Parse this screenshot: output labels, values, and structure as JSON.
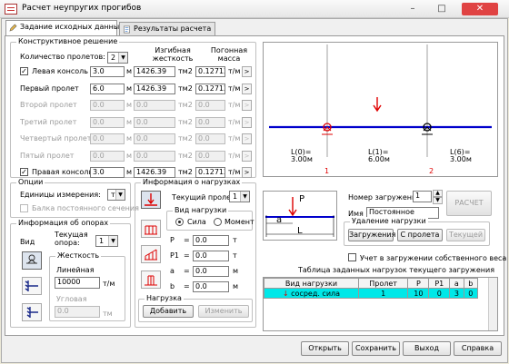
{
  "window": {
    "title": "Расчет неупругих прогибов",
    "controls": [
      "–",
      "□",
      "✕"
    ]
  },
  "tabs": [
    {
      "label": "Задание исходных данных"
    },
    {
      "label": "Результаты расчета"
    }
  ],
  "construct": {
    "legend": "Конструктивное решение",
    "spans_label": "Количество пролетов:",
    "spans_value": "2",
    "hdr_stiff": "Изгибная жесткость",
    "hdr_mass": "Погонная масса",
    "rows": [
      {
        "label": "Левая консоль",
        "checked": true,
        "len": "3.0",
        "unit": "м",
        "stiff": "1426.39",
        "su": "тм2",
        "mass": "0.127125",
        "mu": "т/м",
        "enabled": true
      },
      {
        "label": "Первый пролет",
        "len": "6.0",
        "unit": "м",
        "stiff": "1426.39",
        "su": "тм2",
        "mass": "0.127125",
        "mu": "т/м",
        "enabled": true
      },
      {
        "label": "Второй пролет",
        "len": "0.0",
        "unit": "м",
        "stiff": "0.0",
        "su": "тм2",
        "mass": "0.0",
        "mu": "т/м",
        "enabled": false
      },
      {
        "label": "Третий пролет",
        "len": "0.0",
        "unit": "м",
        "stiff": "0.0",
        "su": "тм2",
        "mass": "0.0",
        "mu": "т/м",
        "enabled": false
      },
      {
        "label": "Четвертый пролет",
        "len": "0.0",
        "unit": "м",
        "stiff": "0.0",
        "su": "тм2",
        "mass": "0.0",
        "mu": "т/м",
        "enabled": false
      },
      {
        "label": "Пятый пролет",
        "len": "0.0",
        "unit": "м",
        "stiff": "0.0",
        "su": "тм2",
        "mass": "0.0",
        "mu": "т/м",
        "enabled": false
      },
      {
        "label": "Правая консоль",
        "checked": true,
        "len": "3.0",
        "unit": "м",
        "stiff": "1426.39",
        "su": "тм2",
        "mass": "0.127125",
        "mu": "т/м",
        "enabled": true
      }
    ],
    "row_button": ">"
  },
  "diagram": {
    "labels": [
      {
        "t": "L(0)=",
        "v": "3.00м"
      },
      {
        "t": "L(1)=",
        "v": "6.00м"
      },
      {
        "t": "L(6)=",
        "v": "3.00м"
      }
    ],
    "support_numbers": [
      "1",
      "2"
    ],
    "colors": {
      "beam": "#0000cc",
      "load": "#e00000",
      "support_num": "#e00000"
    }
  },
  "options": {
    "legend": "Опции",
    "units_label": "Единицы измерения:",
    "units_value": "т",
    "const_section": "Балка постоянного сечения"
  },
  "supports": {
    "legend": "Информация об опорах",
    "view": "Вид",
    "current_label": "Текущая опора:",
    "current_value": "1",
    "stiff_legend": "Жесткость",
    "linear_label": "Линейная",
    "linear_value": "10000",
    "linear_unit": "т/м",
    "angular_label": "Угловая",
    "angular_value": "0.0",
    "angular_unit": "тм"
  },
  "loads": {
    "legend": "Информация о нагрузках",
    "span_label": "Текущий пролет:",
    "span_value": "1",
    "type_legend": "Вид нагрузки",
    "type_force": "Сила",
    "type_moment": "Момент",
    "fields": [
      {
        "label": "P",
        "value": "0.0",
        "unit": "т"
      },
      {
        "label": "P1",
        "value": "0.0",
        "unit": "т"
      },
      {
        "label": "a",
        "value": "0.0",
        "unit": "м"
      },
      {
        "label": "b",
        "value": "0.0",
        "unit": "м"
      }
    ],
    "action_legend": "Нагрузка",
    "add": "Добавить",
    "change": "Изменить"
  },
  "load_scheme": {
    "p": "P",
    "a": "a",
    "l": "L"
  },
  "case": {
    "number_label": "Номер загружения",
    "number_value": "1",
    "name_label": "Имя",
    "name_value": "Постоянное",
    "calc": "РАСЧЕТ",
    "remove_legend": "Удаление нагрузки",
    "remove_case": "Загружения",
    "remove_span": "С пролета",
    "remove_current": "Текущей",
    "selfweight": "Учет в загружении собственного веса"
  },
  "table": {
    "title": "Таблица заданных нагрузок текущего загружения",
    "columns": [
      "Вид нагрузки",
      "Пролет",
      "P",
      "P1",
      "a",
      "b"
    ],
    "rows": [
      [
        "сосред. сила",
        "1",
        "10",
        "0",
        "3",
        "0"
      ]
    ]
  },
  "bottom": {
    "open": "Открыть",
    "save": "Сохранить",
    "exit": "Выход",
    "help": "Справка"
  }
}
